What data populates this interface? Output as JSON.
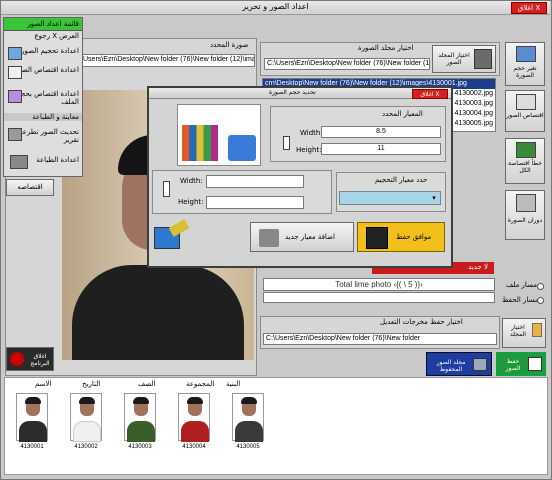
{
  "app": {
    "title": "اعداد الصور و تحرير",
    "close_label": "اغلاق X"
  },
  "menu": {
    "header": "قائمة اعداد الصور",
    "items": [
      {
        "label": "رجوع X العرض"
      },
      {
        "label": "اعدادة تحجيم الصور"
      },
      {
        "label": "اعدادة اقتصاص الصور"
      },
      {
        "label": "اعدادة اقتصاص بحجم الملف"
      },
      {
        "label": "معاينة و الطباعة"
      },
      {
        "label": "تحديث الصور تطرعة تقرير"
      },
      {
        "label": "اعدادة الطباعة"
      }
    ],
    "crop_button": "اقتصاصه"
  },
  "preview": {
    "path_label": "صورة المحدد",
    "path_value": "Users\\Ezn\\Desktop\\New folder (76)\\New folder (12)\\images\\4130001.jpg",
    "close_app": "اغلاق البرنامج"
  },
  "side_buttons": [
    {
      "label": "تغير حجم الصورة"
    },
    {
      "label": "اقتصاص الصور"
    },
    {
      "label": "خطأ اقتصاصة الكل"
    },
    {
      "label": "دوران الصورة"
    }
  ],
  "folder": {
    "title": "اختيار مجلد الصورة",
    "button": "اختيار المجلد الصور",
    "path": "C:\\Users\\Ezn\\Desktop\\New folder (76)\\New folder (12)\\images",
    "files_header": "crn\\Desktop\\New folder (76)\\New folder (12)\\images\\4130001.jpg",
    "files": [
      "4130002.jpg",
      "4130003.jpg",
      "4130004.jpg",
      "4130005.jpg"
    ],
    "no_data": "لا جديد",
    "total_label": "Total lime photo ‹{( \\ 5 )}›"
  },
  "radios": {
    "opt1": "مسار ملف",
    "opt2": "مسار الحفظ"
  },
  "output": {
    "title": "اختيار حفظ مخرجات التعديل",
    "button": "اختيار المجلد",
    "path": "C:\\Users\\Ezn\\Desktop\\New folder (76)\\New folder",
    "save_all": "حفظ الصور",
    "save_folder": "مجلد الصور المحفوظ"
  },
  "resize_dialog": {
    "title": "تحديد حجم الصورة",
    "close_label": "اغلاق X",
    "size_group": "المعيار المحدد",
    "width_label": "Width:",
    "width_value": "8.5",
    "height_label": "Height:",
    "height_value": "11",
    "custom_width_label": "Width:",
    "custom_width_value": "",
    "custom_height_label": "Height:",
    "custom_height_value": "",
    "standard_label": "حدد معيار التحجيم",
    "standard_value": "",
    "add_button": "اضافة معيار جديد",
    "ok_button": "موافق حفظ"
  },
  "gallery": {
    "columns": [
      "الاسم",
      "التاريخ",
      "الصف",
      "المجموعة",
      "البنية"
    ],
    "items": [
      {
        "id": "4130001",
        "shirt": "#2c2c2c"
      },
      {
        "id": "4130002",
        "shirt": "#f0f0f0"
      },
      {
        "id": "4130003",
        "shirt": "#3a5d2a"
      },
      {
        "id": "4130004",
        "shirt": "#b02020"
      },
      {
        "id": "4130005",
        "shirt": "#3a3a3a"
      }
    ]
  }
}
